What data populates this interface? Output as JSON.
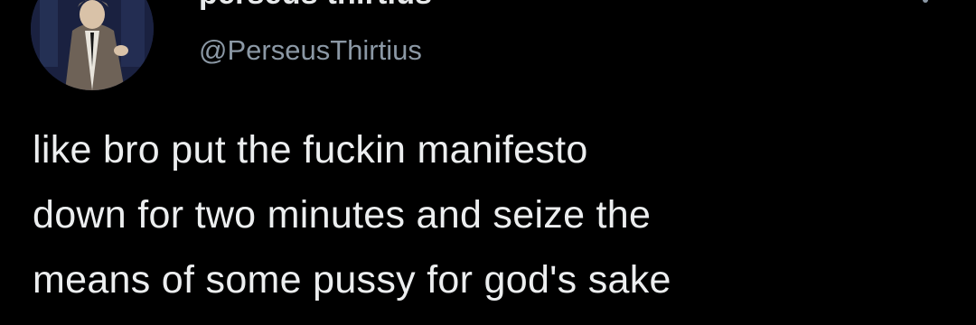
{
  "author": {
    "display_name": "perseus thirtius",
    "handle": "@PerseusThirtius",
    "avatar_icon": "profile-avatar"
  },
  "menu": {
    "icon": "more-options-icon"
  },
  "tweet": {
    "lines": [
      "like bro put the fuckin manifesto",
      "down for two minutes and seize the",
      "means of some pussy for god's sake"
    ]
  },
  "colors": {
    "background": "#000000",
    "primary_text": "#e7e9ea",
    "secondary_text": "#8b98a5"
  }
}
